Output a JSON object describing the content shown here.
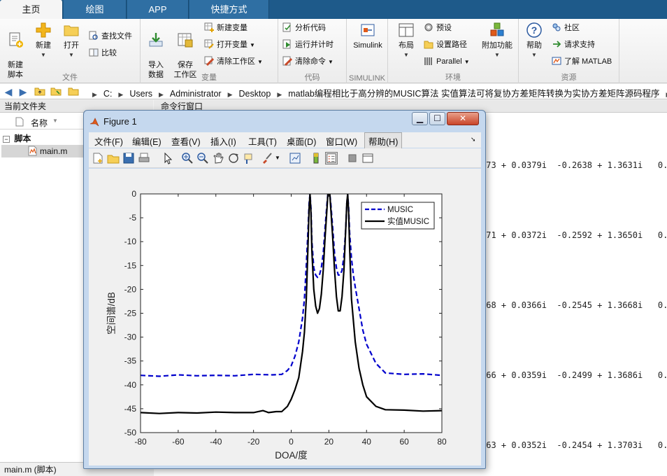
{
  "tabs": [
    "主页",
    "绘图",
    "APP",
    "快捷方式"
  ],
  "ribbon": {
    "file_group": {
      "label": "文件",
      "new_script": "新建\n脚本",
      "new": "新建",
      "open": "打开",
      "find_files": "查找文件",
      "compare": "比较"
    },
    "variable_group": {
      "label": "变量",
      "import": "导入\n数据",
      "save_ws": "保存\n工作区",
      "new_var": "新建变量",
      "open_var": "打开变量",
      "clear_ws": "清除工作区"
    },
    "code_group": {
      "label": "代码",
      "analyze": "分析代码",
      "run_time": "运行并计时",
      "clear_cmds": "清除命令"
    },
    "simulink_group": {
      "label": "SIMULINK",
      "simulink": "Simulink"
    },
    "env_group": {
      "label": "环境",
      "layout": "布局",
      "prefs": "预设",
      "set_path": "设置路径",
      "parallel": "Parallel",
      "addons": "附加功能"
    },
    "resources_group": {
      "label": "资源",
      "help": "帮助",
      "community": "社区",
      "support": "请求支持",
      "learn": "了解 MATLAB"
    }
  },
  "address": {
    "crumbs": [
      "C:",
      "Users",
      "Administrator",
      "Desktop",
      "matlab编程相比于高分辨的MUSIC算法 实值算法可将复协方差矩阵转换为实协方差矩阵源码程序",
      "cod"
    ]
  },
  "left_panel": {
    "title": "当前文件夹",
    "column": "名称",
    "folder": "脚本",
    "file": "main.m",
    "status": "main.m  (脚本)"
  },
  "command_window": {
    "title": "命令行窗口",
    "lines": [
      "073 + 0.0379i  -0.2638 + 1.3631i   0.2",
      "071 + 0.0372i  -0.2592 + 1.3650i   0.2",
      "068 + 0.0366i  -0.2545 + 1.3668i   0.2",
      "066 + 0.0359i  -0.2499 + 1.3686i   0.2",
      "063 + 0.0352i  -0.2454 + 1.3703i   0.2"
    ]
  },
  "figure": {
    "title": "Figure 1",
    "menus": [
      "文件(F)",
      "编辑(E)",
      "查看(V)",
      "插入(I)",
      "工具(T)",
      "桌面(D)",
      "窗口(W)",
      "帮助(H)"
    ]
  },
  "colors": {
    "music": "#0000cc",
    "real_music": "#000000",
    "tab_bar": "#1e5a8a"
  },
  "chart_data": {
    "type": "line",
    "title": "",
    "xlabel": "DOA/度",
    "ylabel": "空间谱/dB",
    "xlim": [
      -80,
      80
    ],
    "ylim": [
      -50,
      0
    ],
    "xticks": [
      -80,
      -60,
      -40,
      -20,
      0,
      20,
      40,
      60,
      80
    ],
    "yticks": [
      0,
      -5,
      -10,
      -15,
      -20,
      -25,
      -30,
      -35,
      -40,
      -45,
      -50
    ],
    "legend_position": "top-right",
    "series": [
      {
        "name": "MUSIC",
        "style": "dashed",
        "x": [
          -80,
          -70,
          -60,
          -50,
          -40,
          -30,
          -20,
          -10,
          -5,
          -2,
          0,
          2,
          4,
          6,
          7,
          8,
          9,
          9.5,
          10,
          10.5,
          11,
          12,
          13,
          14,
          15,
          16,
          17,
          18,
          19,
          19.5,
          20,
          20.5,
          21,
          22,
          23,
          24,
          25,
          26,
          27,
          28,
          29,
          29.5,
          30,
          30.5,
          31,
          32,
          33,
          34,
          36,
          38,
          40,
          45,
          50,
          60,
          70,
          80
        ],
        "y": [
          -38.0,
          -38.2,
          -37.9,
          -38.1,
          -38.0,
          -38.1,
          -37.8,
          -37.9,
          -37.8,
          -37.0,
          -36.0,
          -34.0,
          -31.0,
          -26.0,
          -22.0,
          -15.0,
          -7.0,
          -2.0,
          0.0,
          -3.0,
          -10.0,
          -15.5,
          -17.0,
          -17.5,
          -17.0,
          -15.5,
          -12.5,
          -7.0,
          -2.0,
          0.0,
          0.0,
          0.0,
          -2.0,
          -7.0,
          -12.5,
          -15.5,
          -17.0,
          -17.0,
          -16.0,
          -13.0,
          -7.0,
          -2.0,
          0.0,
          -3.0,
          -8.0,
          -13.5,
          -17.0,
          -19.5,
          -24.0,
          -28.5,
          -31.5,
          -35.5,
          -37.5,
          -37.8,
          -37.7,
          -38.0
        ]
      },
      {
        "name": "实值MUSIC",
        "style": "solid",
        "x": [
          -80,
          -70,
          -60,
          -50,
          -40,
          -30,
          -20,
          -15,
          -12,
          -8,
          -5,
          -2,
          0,
          2,
          4,
          6,
          7,
          8,
          9,
          9.5,
          10,
          10.5,
          11,
          12,
          13,
          14,
          15,
          16,
          17,
          18,
          19,
          19.5,
          20,
          20.5,
          21,
          22,
          23,
          24,
          25,
          26,
          27,
          28,
          29,
          29.5,
          30,
          30.5,
          31,
          32,
          34,
          36,
          38,
          40,
          45,
          50,
          60,
          70,
          80
        ],
        "y": [
          -45.8,
          -46.0,
          -45.8,
          -45.9,
          -45.7,
          -45.8,
          -45.8,
          -45.4,
          -45.8,
          -45.6,
          -45.6,
          -44.5,
          -43.0,
          -41.0,
          -38.5,
          -33.0,
          -29.0,
          -22.0,
          -10.0,
          -3.0,
          0.0,
          -4.0,
          -12.0,
          -20.0,
          -23.5,
          -25.0,
          -24.0,
          -21.0,
          -16.0,
          -9.0,
          -3.0,
          0.0,
          0.0,
          0.0,
          -3.0,
          -9.0,
          -16.0,
          -21.5,
          -24.5,
          -24.5,
          -21.5,
          -16.0,
          -7.0,
          -2.0,
          0.0,
          -4.0,
          -11.0,
          -22.0,
          -31.0,
          -36.5,
          -40.0,
          -42.5,
          -44.5,
          -45.2,
          -45.3,
          -45.5,
          -45.4
        ]
      }
    ]
  }
}
